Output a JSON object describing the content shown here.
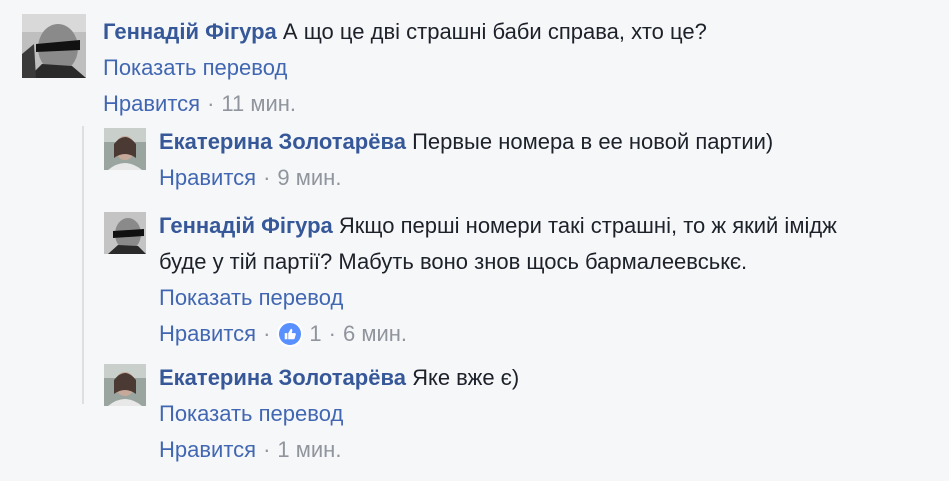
{
  "comments": [
    {
      "author": "Геннадій Фігура",
      "text": "А що це дві страшні баби справа, хто це?",
      "translate_label": "Показать перевод",
      "like_label": "Нравится",
      "time": "11 мин."
    }
  ],
  "replies": [
    {
      "author": "Екатерина Золотарёва",
      "text": "Первые номера в ее новой партии)",
      "like_label": "Нравится",
      "time": "9 мин."
    },
    {
      "author": "Геннадій Фігура",
      "text_line1": "Якщо перші номери такі страшні, то ж який імідж",
      "text_line2": "буде у тій партії? Мабуть воно знов щось бармалеевськє.",
      "translate_label": "Показать перевод",
      "like_label": "Нравится",
      "reaction_count": "1",
      "time": "6 мин."
    },
    {
      "author": "Екатерина Золотарёва",
      "text": "Яке вже є)",
      "translate_label": "Показать перевод",
      "like_label": "Нравится",
      "time": "1 мин."
    }
  ],
  "separator": "·",
  "colors": {
    "author": "#365899",
    "link": "#4267b2",
    "meta": "#90949c",
    "text": "#1d2129",
    "background": "#f6f7f9",
    "like_badge": "#5890ff"
  },
  "icons": {
    "reaction": "thumbs-up-icon"
  }
}
